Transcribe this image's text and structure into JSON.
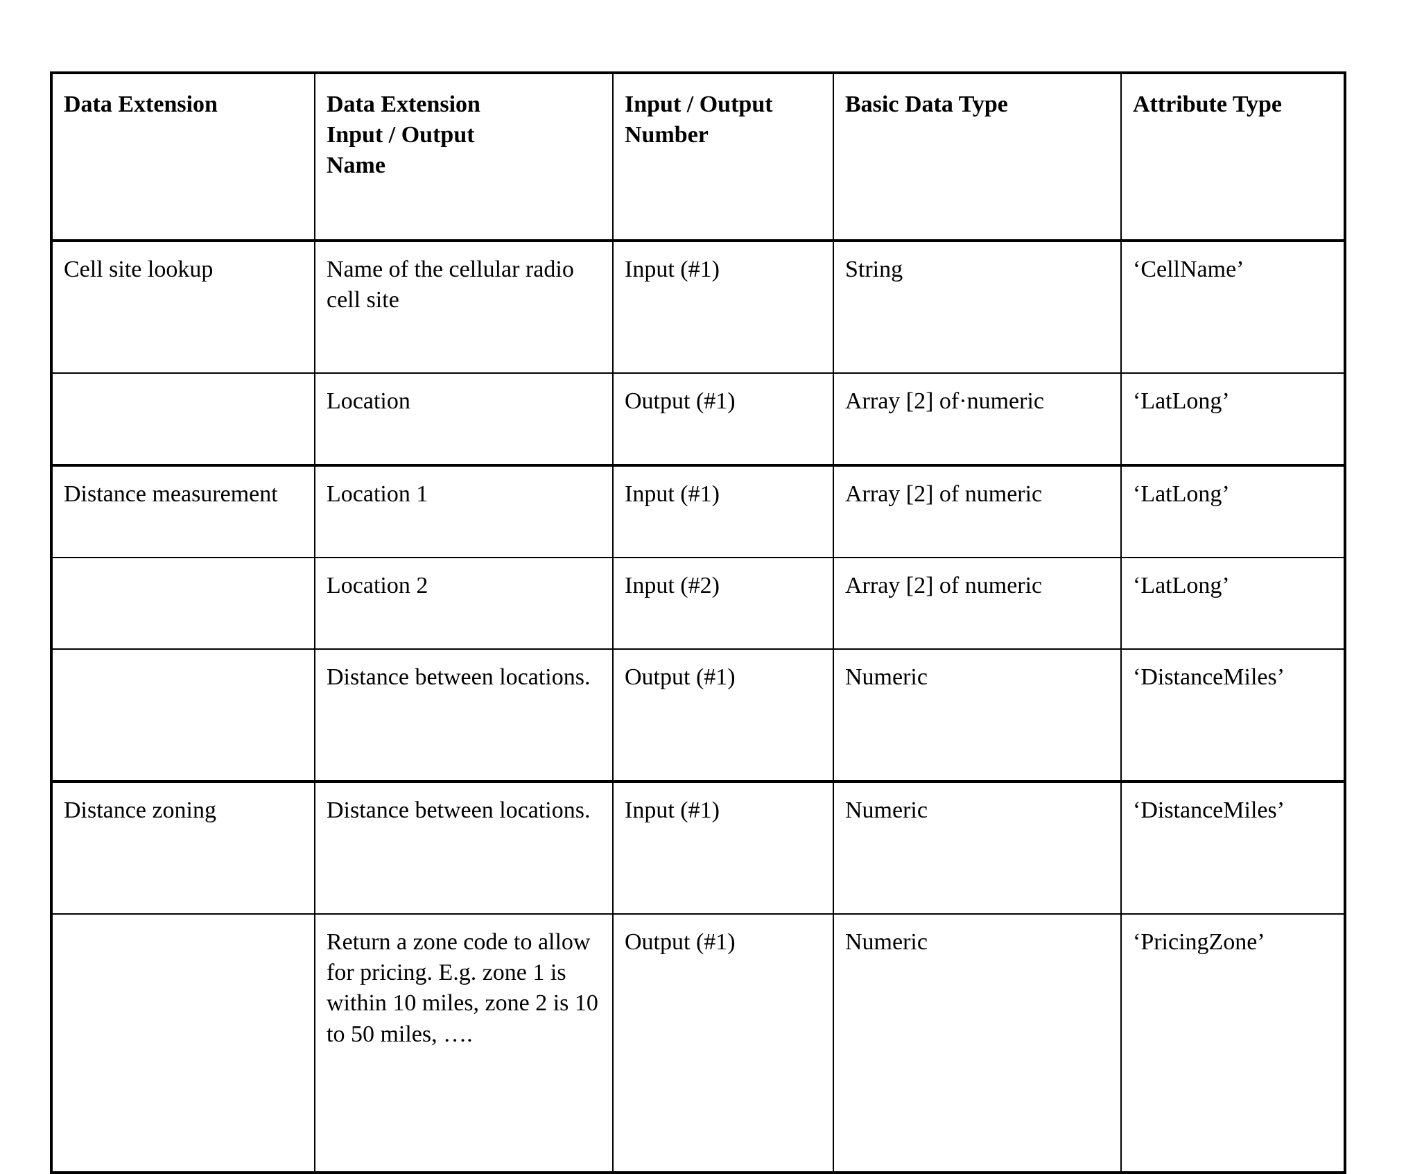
{
  "document": {
    "type": "patent-table",
    "background_color": "#ffffff",
    "text_color": "#000000"
  },
  "table": {
    "columns": [
      {
        "id": "data_extension",
        "label": "Data Extension"
      },
      {
        "id": "io_name",
        "label": "Data Extension Input / Output Name"
      },
      {
        "id": "io_number",
        "label": "Input / Output Number"
      },
      {
        "id": "basic_data_type",
        "label": "Basic Data Type"
      },
      {
        "id": "attribute_type",
        "label": "Attribute Type"
      }
    ],
    "header": {
      "col1": "Data Extension",
      "col2_line1": "Data Extension",
      "col2_line2": "Input / Output",
      "col2_line3": "Name",
      "col3_line1": "Input / Output",
      "col3_line2": "Number",
      "col4": "Basic Data Type",
      "col5": "Attribute Type"
    },
    "rows": [
      {
        "group": "Cell site lookup",
        "data_extension": "Cell site lookup",
        "io_name": "Name of the cellular radio cell site",
        "io_number": "Input (#1)",
        "basic_data_type": "String",
        "attribute_type": "‘CellName’"
      },
      {
        "group": "Cell site lookup",
        "data_extension": "",
        "io_name": "Location",
        "io_number": "Output (#1)",
        "basic_data_type": "Array [2] of·numeric",
        "attribute_type": "‘LatLong’"
      },
      {
        "group": "Distance measurement",
        "data_extension": "Distance measurement",
        "io_name": "Location 1",
        "io_number": "Input (#1)",
        "basic_data_type": "Array [2] of numeric",
        "attribute_type": "‘LatLong’"
      },
      {
        "group": "Distance measurement",
        "data_extension": "",
        "io_name": "Location 2",
        "io_number": "Input (#2)",
        "basic_data_type": "Array [2] of numeric",
        "attribute_type": "‘LatLong’"
      },
      {
        "group": "Distance measurement",
        "data_extension": "",
        "io_name": "Distance between locations.",
        "io_number": "Output (#1)",
        "basic_data_type": "Numeric",
        "attribute_type": "‘DistanceMiles’"
      },
      {
        "group": "Distance zoning",
        "data_extension": "Distance zoning",
        "io_name": "Distance between locations.",
        "io_number": "Input (#1)",
        "basic_data_type": "Numeric",
        "attribute_type": "‘DistanceMiles’"
      },
      {
        "group": "Distance zoning",
        "data_extension": "",
        "io_name": "Return a zone code to allow for pricing. E.g. zone 1 is within 10 miles, zone 2 is 10 to 50 miles, ….",
        "io_number": "Output (#1)",
        "basic_data_type": "Numeric",
        "attribute_type": "‘PricingZone’"
      }
    ]
  }
}
